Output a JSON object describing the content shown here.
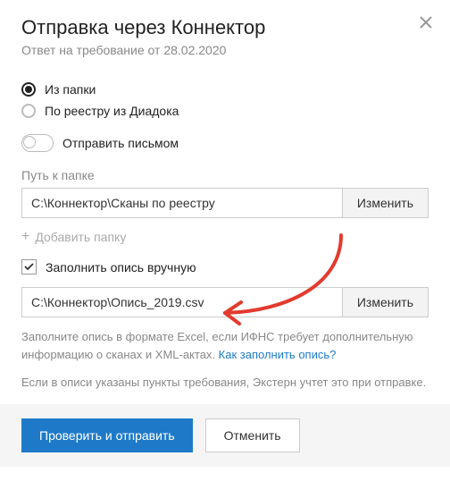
{
  "dialog": {
    "title": "Отправка через Коннектор",
    "subtitle": "Ответ на требование от 28.02.2020"
  },
  "source": {
    "from_folder_label": "Из папки",
    "from_diadoc_label": "По реестру из Диадока"
  },
  "toggle": {
    "send_letter_label": "Отправить письмом"
  },
  "path": {
    "label": "Путь к папке",
    "value": "C:\\Коннектор\\Сканы по реестру",
    "change_label": "Изменить"
  },
  "add_folder_label": "Добавить папку",
  "manual_inventory": {
    "label": "Заполнить опись вручную"
  },
  "inventory_path": {
    "value": "C:\\Коннектор\\Опись_2019.csv",
    "change_label": "Изменить"
  },
  "help": {
    "text": "Заполните опись в формате Excel, если ИФНС требует дополнительную информацию о сканах и XML-актах. ",
    "link": "Как заполнить опись?"
  },
  "note": "Если в описи указаны пункты требования, Экстерн учтет это при отправке.",
  "footer": {
    "primary": "Проверить и отправить",
    "secondary": "Отменить"
  }
}
